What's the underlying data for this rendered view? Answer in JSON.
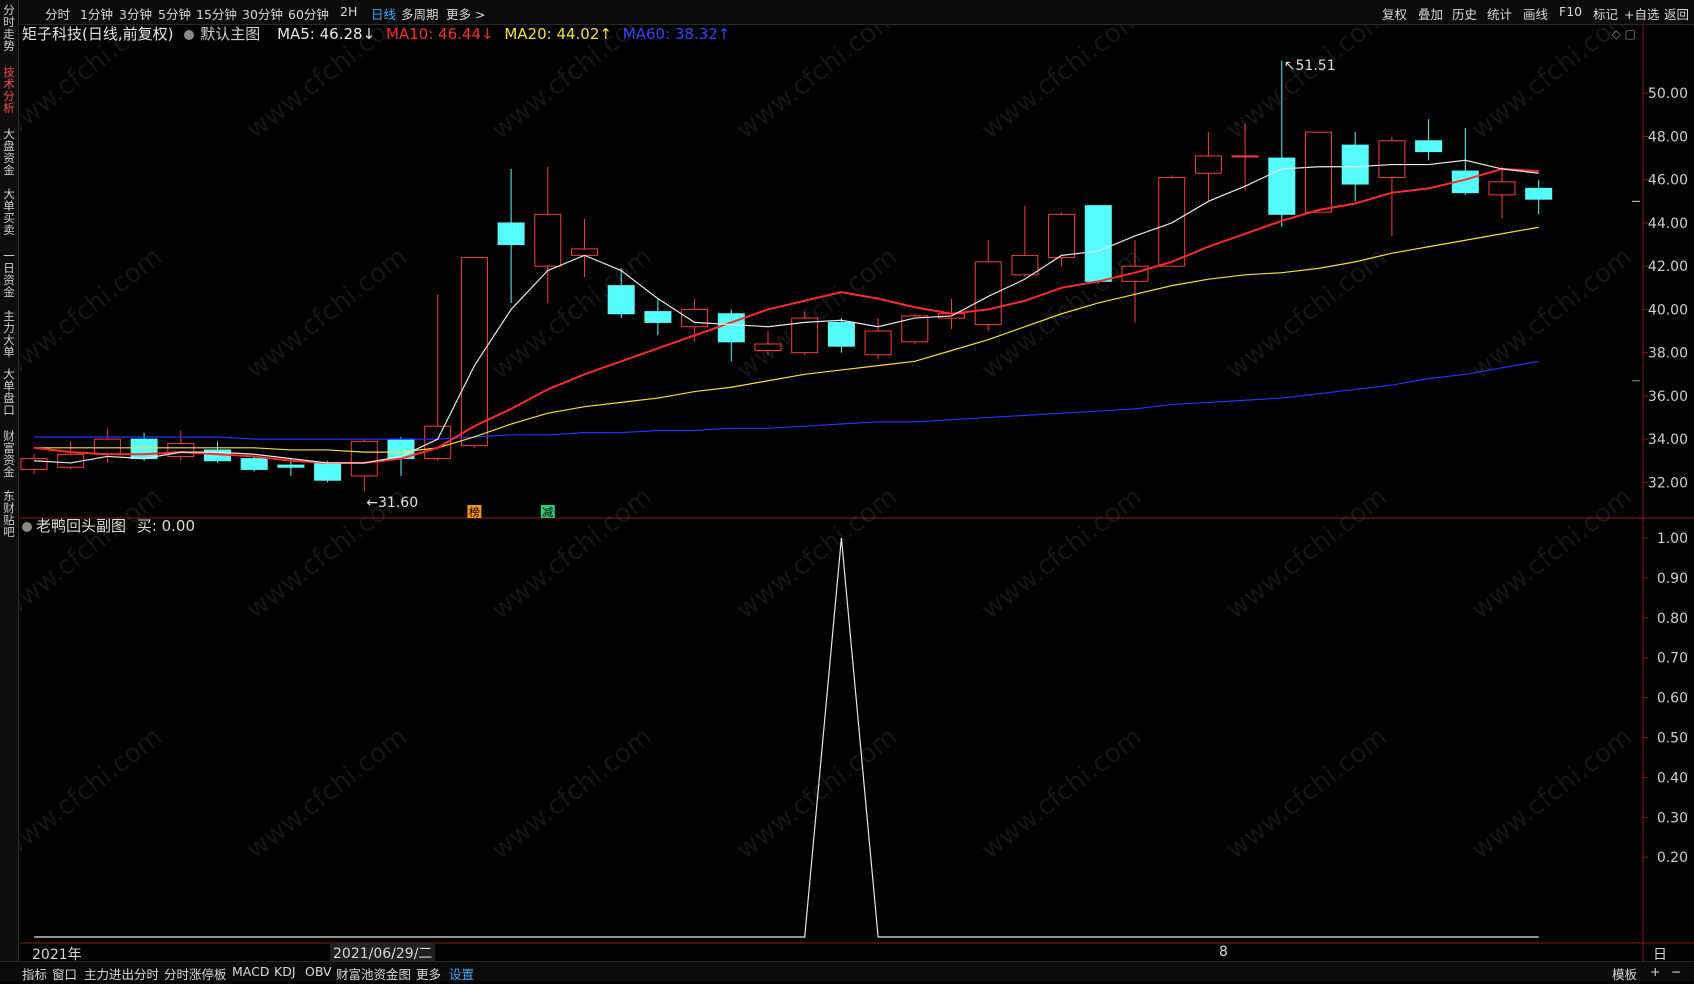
{
  "topbar": {
    "left": [
      {
        "label": "分时",
        "x": 45
      },
      {
        "label": "1分钟",
        "x": 80
      },
      {
        "label": "3分钟",
        "x": 119
      },
      {
        "label": "5分钟",
        "x": 158
      },
      {
        "label": "15分钟",
        "x": 196
      },
      {
        "label": "30分钟",
        "x": 242
      },
      {
        "label": "60分钟",
        "x": 288
      },
      {
        "label": "2H",
        "x": 340
      },
      {
        "label": "日线",
        "x": 371,
        "active": true
      },
      {
        "label": "多周期",
        "x": 401
      },
      {
        "label": "更多 >",
        "x": 446
      }
    ],
    "right": [
      {
        "label": "复权",
        "x": 1382
      },
      {
        "label": "叠加",
        "x": 1418
      },
      {
        "label": "历史",
        "x": 1452
      },
      {
        "label": "统计",
        "x": 1487
      },
      {
        "label": "画线",
        "x": 1523
      },
      {
        "label": "F10",
        "x": 1559
      },
      {
        "label": "标记",
        "x": 1593
      },
      {
        "label": "+自选",
        "x": 1624
      },
      {
        "label": "返回",
        "x": 1664
      }
    ]
  },
  "leftrail": [
    {
      "label": "分时走势",
      "y": 4
    },
    {
      "label": "技术分析",
      "y": 66,
      "active": true
    },
    {
      "label": "大盘资金",
      "y": 128
    },
    {
      "label": "大单买卖",
      "y": 188
    },
    {
      "label": "一日资金",
      "y": 250
    },
    {
      "label": "主力大单",
      "y": 310
    },
    {
      "label": "大单盘口",
      "y": 368
    },
    {
      "label": "财富资金",
      "y": 430
    },
    {
      "label": "东财贴吧",
      "y": 490
    }
  ],
  "info": {
    "stock": "矩子科技(日线,前复权)",
    "main": "默认主图",
    "ma5": {
      "label": "MA5: 46.28↓",
      "color": "#e8e8e8"
    },
    "ma10": {
      "label": "MA10: 46.44↓",
      "color": "#ff2a2a"
    },
    "ma20": {
      "label": "MA20: 44.02↑",
      "color": "#f5e22b"
    },
    "ma60": {
      "label": "MA60: 38.32↑",
      "color": "#2233ff"
    }
  },
  "sub": {
    "title": "老鸭回头副图",
    "buy": "买: 0.00"
  },
  "bottombar": [
    {
      "label": "指标",
      "x": 22
    },
    {
      "label": "窗口",
      "x": 52
    },
    {
      "label": "主力进出分时",
      "x": 84
    },
    {
      "label": "分时涨停板",
      "x": 164
    },
    {
      "label": "MACD",
      "x": 232
    },
    {
      "label": "KDJ",
      "x": 274
    },
    {
      "label": "OBV",
      "x": 305
    },
    {
      "label": "财富池资金图",
      "x": 336
    },
    {
      "label": "更多",
      "x": 416
    },
    {
      "label": "设置",
      "x": 449,
      "active": true
    },
    {
      "label": "模板",
      "x": 1612
    },
    {
      "label": "+",
      "x": 1650
    },
    {
      "label": "−",
      "x": 1671
    }
  ],
  "datebar": {
    "left": "2021年",
    "mid": "2021/06/29/二",
    "month": "8",
    "right": "日线"
  },
  "chart_data": [
    {
      "type": "candlestick",
      "title": "矩子科技(日线,前复权)",
      "ylim": [
        31.0,
        52.0
      ],
      "yticks": [
        32,
        34,
        36,
        38,
        40,
        42,
        44,
        46,
        48,
        50
      ],
      "ytick_labels": [
        "32.00",
        "34.00",
        "36.00",
        "38.00",
        "40.00",
        "42.00",
        "44.00",
        "46.00",
        "48.00",
        "50.00"
      ],
      "colors": {
        "up": "#ff3b3b",
        "down": "#54fcfc",
        "ma5": "#e8e8e8",
        "ma10": "#ff2a2a",
        "ma20": "#f5e22b",
        "ma60": "#2233ff"
      },
      "candles": [
        {
          "o": 32.6,
          "c": 33.1,
          "h": 33.3,
          "l": 32.4
        },
        {
          "o": 32.7,
          "c": 33.3,
          "h": 33.9,
          "l": 32.6
        },
        {
          "o": 33.3,
          "c": 34.0,
          "h": 34.5,
          "l": 32.9
        },
        {
          "o": 34.0,
          "c": 33.1,
          "h": 34.3,
          "l": 33.0
        },
        {
          "o": 33.2,
          "c": 33.8,
          "h": 34.4,
          "l": 33.0
        },
        {
          "o": 33.5,
          "c": 33.0,
          "h": 33.9,
          "l": 32.9
        },
        {
          "o": 33.1,
          "c": 32.6,
          "h": 33.2,
          "l": 32.5
        },
        {
          "o": 32.8,
          "c": 32.7,
          "h": 33.1,
          "l": 32.3
        },
        {
          "o": 32.9,
          "c": 32.1,
          "h": 33.0,
          "l": 32.0
        },
        {
          "o": 32.3,
          "c": 33.9,
          "h": 34.0,
          "l": 31.6
        },
        {
          "o": 34.0,
          "c": 33.1,
          "h": 34.1,
          "l": 32.3
        },
        {
          "o": 33.1,
          "c": 34.6,
          "h": 40.7,
          "l": 33.0
        },
        {
          "o": 33.7,
          "c": 42.4,
          "h": 42.4,
          "l": 33.6
        },
        {
          "o": 44.0,
          "c": 43.0,
          "h": 46.5,
          "l": 40.3
        },
        {
          "o": 42.0,
          "c": 44.4,
          "h": 46.6,
          "l": 40.3
        },
        {
          "o": 42.5,
          "c": 42.8,
          "h": 44.2,
          "l": 41.5
        },
        {
          "o": 41.1,
          "c": 39.8,
          "h": 41.9,
          "l": 39.6
        },
        {
          "o": 39.9,
          "c": 39.4,
          "h": 40.5,
          "l": 38.8
        },
        {
          "o": 39.2,
          "c": 40.0,
          "h": 40.5,
          "l": 38.5
        },
        {
          "o": 39.8,
          "c": 38.5,
          "h": 40.0,
          "l": 37.6
        },
        {
          "o": 38.1,
          "c": 38.4,
          "h": 39.0,
          "l": 37.9
        },
        {
          "o": 38.0,
          "c": 39.6,
          "h": 39.9,
          "l": 37.9
        },
        {
          "o": 39.4,
          "c": 38.3,
          "h": 39.6,
          "l": 38.0
        },
        {
          "o": 37.9,
          "c": 39.0,
          "h": 39.6,
          "l": 37.7
        },
        {
          "o": 38.5,
          "c": 39.7,
          "h": 39.8,
          "l": 38.4
        },
        {
          "o": 39.6,
          "c": 39.8,
          "h": 40.5,
          "l": 39.1
        },
        {
          "o": 39.3,
          "c": 42.2,
          "h": 43.2,
          "l": 39.0
        },
        {
          "o": 41.6,
          "c": 42.5,
          "h": 44.8,
          "l": 41.5
        },
        {
          "o": 42.4,
          "c": 44.4,
          "h": 44.5,
          "l": 42.0
        },
        {
          "o": 44.8,
          "c": 41.3,
          "h": 44.8,
          "l": 41.2
        },
        {
          "o": 41.3,
          "c": 42.0,
          "h": 43.2,
          "l": 39.4
        },
        {
          "o": 42.0,
          "c": 46.1,
          "h": 46.2,
          "l": 42.0
        },
        {
          "o": 46.3,
          "c": 47.1,
          "h": 48.2,
          "l": 45.0
        },
        {
          "o": 47.1,
          "c": 47.1,
          "h": 48.6,
          "l": 45.5
        },
        {
          "o": 47.0,
          "c": 44.4,
          "h": 51.5,
          "l": 43.8
        },
        {
          "o": 44.5,
          "c": 48.2,
          "h": 48.2,
          "l": 44.5
        },
        {
          "o": 47.6,
          "c": 45.8,
          "h": 48.2,
          "l": 45.0
        },
        {
          "o": 46.1,
          "c": 47.8,
          "h": 48.0,
          "l": 43.4
        },
        {
          "o": 47.8,
          "c": 47.3,
          "h": 48.8,
          "l": 46.9
        },
        {
          "o": 46.4,
          "c": 45.4,
          "h": 48.4,
          "l": 45.3
        },
        {
          "o": 45.3,
          "c": 45.9,
          "h": 46.6,
          "l": 44.2
        },
        {
          "o": 45.6,
          "c": 45.1,
          "h": 46.0,
          "l": 44.4
        }
      ],
      "ma5": [
        33.0,
        32.9,
        33.2,
        33.1,
        33.4,
        33.4,
        33.3,
        33.1,
        32.9,
        32.9,
        33.2,
        34.0,
        37.4,
        40.0,
        41.8,
        42.5,
        41.8,
        40.5,
        39.4,
        39.3,
        39.2,
        39.4,
        39.5,
        39.2,
        39.6,
        39.7,
        40.6,
        41.4,
        42.5,
        42.7,
        43.4,
        44.0,
        45.0,
        45.7,
        46.5,
        46.6,
        46.6,
        46.7,
        46.7,
        46.9,
        46.5,
        46.3
      ],
      "ma10": [
        33.6,
        33.4,
        33.3,
        33.3,
        33.4,
        33.3,
        33.2,
        33.0,
        32.9,
        32.9,
        33.1,
        33.6,
        34.6,
        35.4,
        36.3,
        37.0,
        37.6,
        38.2,
        38.8,
        39.4,
        40.0,
        40.4,
        40.8,
        40.5,
        40.1,
        39.8,
        40.0,
        40.4,
        41.0,
        41.3,
        41.7,
        42.2,
        42.9,
        43.5,
        44.1,
        44.6,
        44.9,
        45.4,
        45.6,
        46.0,
        46.5,
        46.4
      ],
      "ma20": [
        33.6,
        33.6,
        33.6,
        33.6,
        33.6,
        33.6,
        33.6,
        33.5,
        33.5,
        33.4,
        33.4,
        33.6,
        34.1,
        34.7,
        35.2,
        35.5,
        35.7,
        35.9,
        36.2,
        36.4,
        36.7,
        37.0,
        37.2,
        37.4,
        37.6,
        38.1,
        38.6,
        39.2,
        39.8,
        40.3,
        40.7,
        41.1,
        41.4,
        41.6,
        41.7,
        41.9,
        42.2,
        42.6,
        42.9,
        43.2,
        43.5,
        43.8
      ],
      "ma60": [
        34.1,
        34.1,
        34.1,
        34.1,
        34.1,
        34.1,
        34.0,
        34.0,
        34.0,
        34.0,
        34.0,
        34.0,
        34.1,
        34.2,
        34.2,
        34.3,
        34.3,
        34.4,
        34.4,
        34.5,
        34.5,
        34.6,
        34.7,
        34.8,
        34.8,
        34.9,
        35.0,
        35.1,
        35.2,
        35.3,
        35.4,
        35.6,
        35.7,
        35.8,
        35.9,
        36.1,
        36.3,
        36.5,
        36.8,
        37.0,
        37.3,
        37.6
      ],
      "annotations": {
        "high": "51.51",
        "low": "31.60",
        "markers": [
          {
            "label": "榜",
            "color": "#f7931e"
          },
          {
            "label": "减",
            "color": "#2ecc71"
          }
        ]
      }
    },
    {
      "type": "line",
      "title": "老鸭回头副图",
      "ylim": [
        0,
        1.0
      ],
      "yticks": [
        0.2,
        0.3,
        0.4,
        0.5,
        0.6,
        0.7,
        0.8,
        0.9,
        1.0
      ],
      "ytick_labels": [
        "0.20",
        "0.30",
        "0.40",
        "0.50",
        "0.60",
        "0.70",
        "0.80",
        "0.90",
        "1.00"
      ],
      "values": [
        0,
        0,
        0,
        0,
        0,
        0,
        0,
        0,
        0,
        0,
        0,
        0,
        0,
        0,
        0,
        0,
        0,
        0,
        0,
        0,
        0,
        0,
        1,
        0,
        0,
        0,
        0,
        0,
        0,
        0,
        0,
        0,
        0,
        0,
        0,
        0,
        0,
        0,
        0,
        0,
        0,
        0
      ]
    }
  ]
}
